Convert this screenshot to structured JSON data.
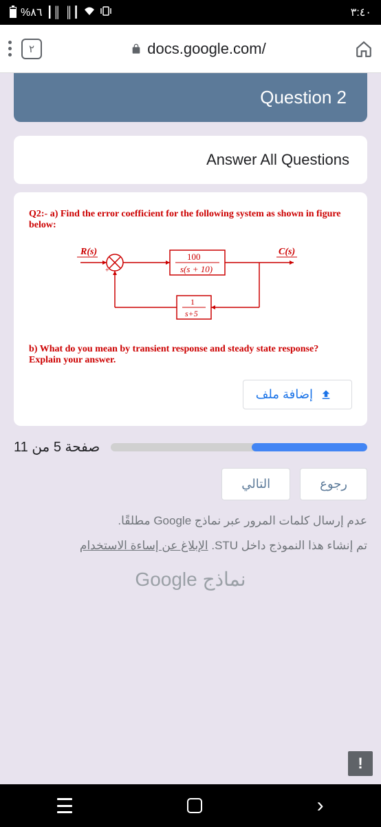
{
  "status": {
    "battery_pct": "%٨٦",
    "time": "٣:٤٠"
  },
  "browser": {
    "tabs_count": "٢",
    "url": "docs.google.com/"
  },
  "form": {
    "header": "Question 2",
    "section_title": "Answer All Questions",
    "question": {
      "prompt_a": "Q2:- a) Find the error coefficient for the following system as shown in figure below:",
      "labels": {
        "input": "R(s)",
        "forward": "100",
        "forward_denom": "s(s + 10)",
        "feedback_num": "1",
        "feedback_denom": "s+5",
        "output": "C(s)"
      },
      "prompt_b": "b) What do you mean by transient response and steady state response? Explain your answer.",
      "upload_label": "إضافة ملف"
    },
    "progress": {
      "text": "صفحة 5 من 11"
    },
    "nav": {
      "back": "رجوع",
      "next": "التالي"
    },
    "disclaimer": "عدم إرسال كلمات المرور عبر نماذج Google مطلقًا.",
    "created_in_prefix": "تم إنشاء هذا النموذج داخل STU. ",
    "report_link": "الإبلاغ عن إساءة الاستخدام",
    "google_forms": "نماذج Google",
    "report_badge": "!"
  }
}
